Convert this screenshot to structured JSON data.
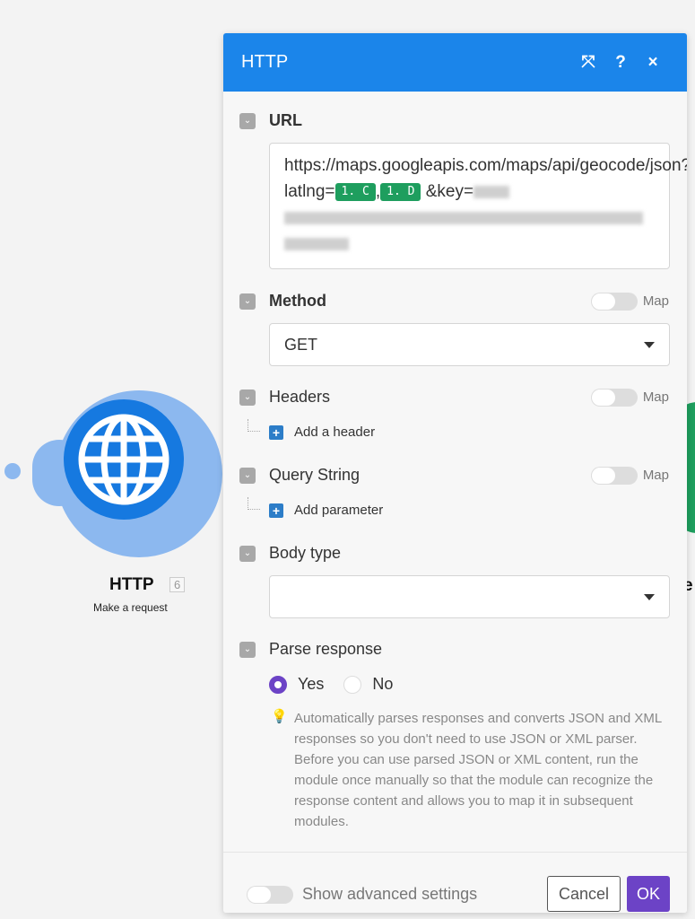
{
  "canvas": {
    "node": {
      "title": "HTTP",
      "badge": "6",
      "subtitle": "Make a request",
      "icon": "globe-icon",
      "color": "#1679e0"
    },
    "next_node": {
      "title_fragment": "e",
      "color": "#1e9e5e"
    }
  },
  "dialog": {
    "title": "HTTP",
    "header_icons": [
      "expand-icon",
      "help-icon",
      "close-icon"
    ],
    "header_glyphs": {
      "expand": "⤧",
      "help": "?",
      "close": "×"
    },
    "url": {
      "label": "URL",
      "prefix": "https://maps.googleapis.com/maps/api/geocode/json?latlng=",
      "pill1": "1. C",
      "sep": ",",
      "pill2": "1. D",
      "suffix": " &key="
    },
    "method": {
      "label": "Method",
      "map": "Map",
      "value": "GET"
    },
    "headers": {
      "label": "Headers",
      "map": "Map",
      "add": "Add a header"
    },
    "query": {
      "label": "Query String",
      "map": "Map",
      "add": "Add parameter"
    },
    "body_type": {
      "label": "Body type",
      "value": ""
    },
    "parse": {
      "label": "Parse response",
      "options": [
        "Yes",
        "No"
      ],
      "selected": "Yes",
      "hint": "Automatically parses responses and converts JSON and XML responses so you don't need to use JSON or XML parser. Before you can use parsed JSON or XML content, run the module once manually so that the module can recognize the response content and allows you to map it in subsequent modules."
    },
    "footer": {
      "advanced": "Show advanced settings",
      "cancel": "Cancel",
      "ok": "OK"
    },
    "colors": {
      "header": "#1b85ea",
      "accent": "#6c43c6",
      "pill": "#1e9e5e"
    }
  }
}
